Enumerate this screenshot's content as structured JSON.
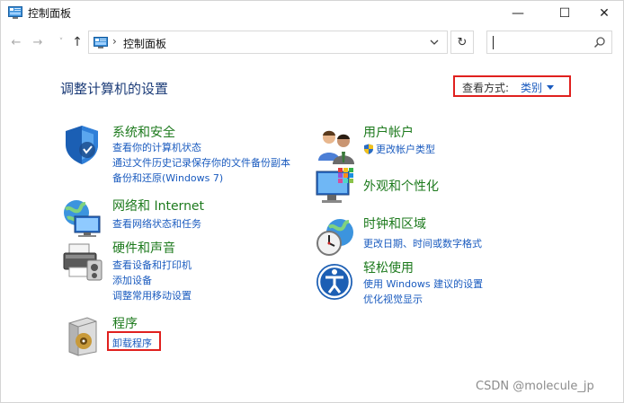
{
  "window": {
    "title": "控制面板",
    "controls": {
      "minimize": "—",
      "maximize": "☐",
      "close": "✕"
    }
  },
  "toolbar": {
    "back": "←",
    "forward": "→",
    "recent": "˅",
    "up": "↑",
    "breadcrumb_sep": "›",
    "breadcrumb": "控制面板",
    "refresh": "↻",
    "search_placeholder": ""
  },
  "main": {
    "heading": "调整计算机的设置",
    "view_by_label": "查看方式:",
    "view_by_value": "类别"
  },
  "categories": {
    "system": {
      "title": "系统和安全",
      "icon": "shield-icon",
      "links": [
        "查看你的计算机状态",
        "通过文件历史记录保存你的文件备份副本",
        "备份和还原(Windows 7)"
      ]
    },
    "network": {
      "title": "网络和 Internet",
      "icon": "network-globe-icon",
      "links": [
        "查看网络状态和任务"
      ]
    },
    "hardware": {
      "title": "硬件和声音",
      "icon": "printer-icon",
      "links": [
        "查看设备和打印机",
        "添加设备",
        "调整常用移动设置"
      ]
    },
    "programs": {
      "title": "程序",
      "icon": "program-disc-icon",
      "links": [
        "卸载程序"
      ]
    },
    "accounts": {
      "title": "用户帐户",
      "icon": "users-icon",
      "links": [
        "更改帐户类型"
      ]
    },
    "appearance": {
      "title": "外观和个性化",
      "icon": "monitor-palette-icon",
      "links": []
    },
    "clock": {
      "title": "时钟和区域",
      "icon": "clock-globe-icon",
      "links": [
        "更改日期、时间或数字格式"
      ]
    },
    "ease": {
      "title": "轻松使用",
      "icon": "ease-of-access-icon",
      "links": [
        "使用 Windows 建议的设置",
        "优化视觉显示"
      ]
    }
  },
  "watermark": "CSDN @molecule_jp",
  "colors": {
    "title_green": "#1d7a1d",
    "link_blue": "#1a5bbf",
    "heading_blue": "#1c3c78",
    "highlight_red": "#e0201e"
  }
}
